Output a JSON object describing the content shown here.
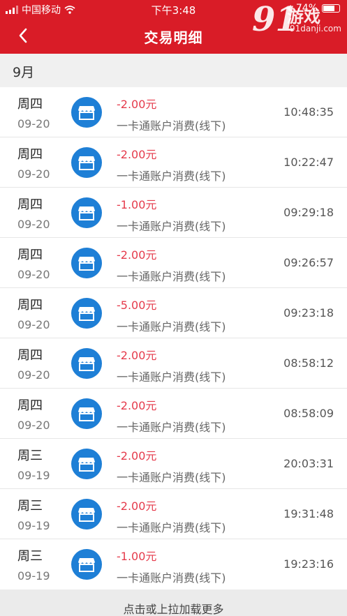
{
  "status_bar": {
    "carrier": "中国移动",
    "time": "下午3:48",
    "battery": "74%",
    "battery_level": 0.74
  },
  "header": {
    "title": "交易明细",
    "back_icon": "chevron-left-icon",
    "color": "#d91c27"
  },
  "watermark": {
    "number": "91",
    "text": "游戏",
    "url": "91danji.com"
  },
  "month": "9月",
  "transactions": [
    {
      "weekday": "周四",
      "date": "09-20",
      "amount": "-2.00元",
      "desc": "一卡通账户消费(线下)",
      "time": "10:48:35"
    },
    {
      "weekday": "周四",
      "date": "09-20",
      "amount": "-2.00元",
      "desc": "一卡通账户消费(线下)",
      "time": "10:22:47"
    },
    {
      "weekday": "周四",
      "date": "09-20",
      "amount": "-1.00元",
      "desc": "一卡通账户消费(线下)",
      "time": "09:29:18"
    },
    {
      "weekday": "周四",
      "date": "09-20",
      "amount": "-2.00元",
      "desc": "一卡通账户消费(线下)",
      "time": "09:26:57"
    },
    {
      "weekday": "周四",
      "date": "09-20",
      "amount": "-5.00元",
      "desc": "一卡通账户消费(线下)",
      "time": "09:23:18"
    },
    {
      "weekday": "周四",
      "date": "09-20",
      "amount": "-2.00元",
      "desc": "一卡通账户消费(线下)",
      "time": "08:58:12"
    },
    {
      "weekday": "周四",
      "date": "09-20",
      "amount": "-2.00元",
      "desc": "一卡通账户消费(线下)",
      "time": "08:58:09"
    },
    {
      "weekday": "周三",
      "date": "09-19",
      "amount": "-2.00元",
      "desc": "一卡通账户消费(线下)",
      "time": "20:03:31"
    },
    {
      "weekday": "周三",
      "date": "09-19",
      "amount": "-2.00元",
      "desc": "一卡通账户消费(线下)",
      "time": "19:31:48"
    },
    {
      "weekday": "周三",
      "date": "09-19",
      "amount": "-1.00元",
      "desc": "一卡通账户消费(线下)",
      "time": "19:23:16"
    }
  ],
  "transaction_icon": "store-icon",
  "accent_colors": {
    "amount": "#e53a4b",
    "icon": "#1e7fd6"
  },
  "load_more": "点击或上拉加载更多"
}
